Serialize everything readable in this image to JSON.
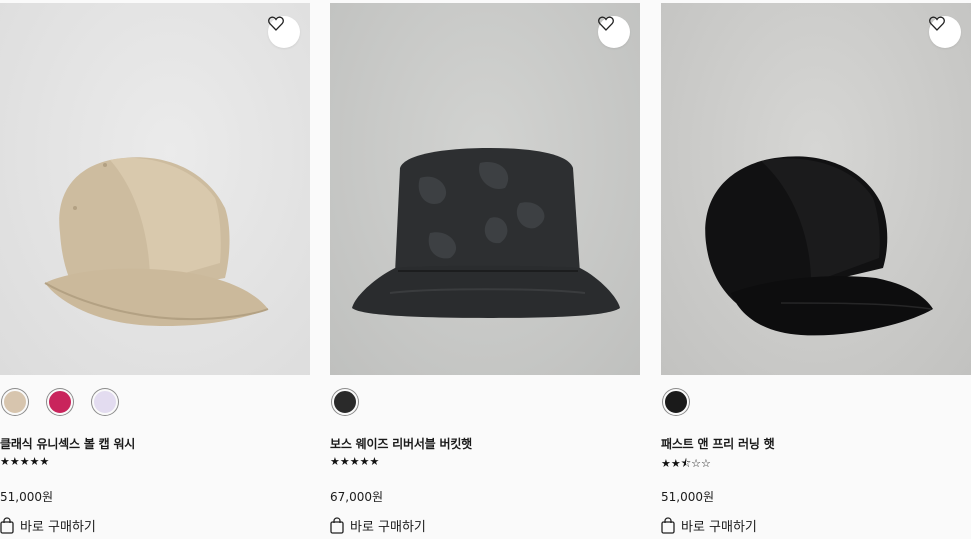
{
  "products": [
    {
      "name": "클래식 유니섹스 볼 캡 워시",
      "rating_stars": "★★★★★",
      "rating": 5,
      "price": "51,000원",
      "buy_label": "바로 구매하기",
      "swatches": [
        "#d7c5ae",
        "#c9245c",
        "#e3dcf0"
      ]
    },
    {
      "name": "보스 웨이즈 리버서블 버킷햇",
      "rating_stars": "★★★★★",
      "rating": 5,
      "price": "67,000원",
      "buy_label": "바로 구매하기",
      "swatches": [
        "#2a2a2a"
      ]
    },
    {
      "name": "패스트 앤 프리 러닝 햇",
      "rating_stars": "★★⯪☆☆",
      "rating": 2.5,
      "price": "51,000원",
      "buy_label": "바로 구매하기",
      "swatches": [
        "#1a1a1a"
      ]
    }
  ],
  "icons": {
    "wishlist": "heart-icon",
    "buy": "shopping-bag-icon"
  }
}
